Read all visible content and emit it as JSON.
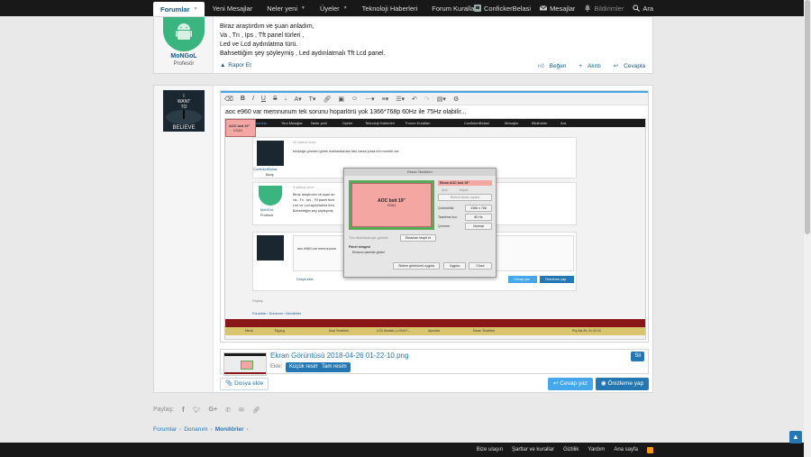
{
  "nav": {
    "tabs": [
      {
        "label": "Forumlar",
        "active": true
      },
      {
        "label": "Yeni Mesajlar"
      },
      {
        "label": "Neler yeni"
      },
      {
        "label": "Üyeler"
      },
      {
        "label": "Teknoloji Haberleri"
      },
      {
        "label": "Forum Kuralları"
      }
    ],
    "user": "ConfickerBelasi",
    "messages": "Mesajlar",
    "alerts": "Bildirimler",
    "search": "Ara"
  },
  "post1": {
    "username": "MoNGoL",
    "usertitle": "Profesör",
    "lines": [
      "Biraz araştırdım ve şuan anladım,",
      "Va , Tn , Ips , Tft panel türleri ,",
      "Led ve Lcd aydınlatma türü.",
      "Bahsettiğim şey şöyleymiş , Led aydınlatmalı Tft Lcd panel."
    ],
    "report": "Rapor Et",
    "like": "Beğen",
    "quote": "Alıntı",
    "reply": "Cevapla"
  },
  "reply": {
    "believe_lines": [
      "I",
      "WANT",
      "TO",
      "BELIEVE"
    ],
    "editor_text": "aoc e960 var memnunum tek sorunu hoparlörü yok 1366*768p 60Hz ile 75Hz olabilir...",
    "shot": {
      "nav": [
        "Forumlar",
        "Yeni Mesajlar",
        "Neler yeni",
        "Üyeler",
        "Teknoloji Haberleri",
        "Forum Kuralları"
      ],
      "nav_right": [
        "ConfickerBelasi",
        "Mesajlar",
        "Bildirimler",
        "Ara"
      ],
      "time1": "20 dakika önce",
      "text1": "sıkıştığa çıkmam gerek dokkantlardan fakı varsa yolsa teıl monitör var.",
      "user1": "ConfickerBelasi",
      "user1_title": "Bahş",
      "time2": "3 dakika önce",
      "user2": "MoNGoL",
      "user2_title": "Profesör",
      "text2": [
        "Biraz araştırdım ve şuan an",
        "Va , Tn , Ips , Tft panel türle",
        "Led ve Lcd aydınlatma türü.",
        "Bahsettiğim şey şöyleymiş"
      ],
      "editor_text": "aoc e960 var memnunum",
      "attach": "Dosya ekle",
      "reply": "Cevap yaz",
      "preview": "Önizleme yap",
      "share": "Paylaş:",
      "crumbs": [
        "Forumlar",
        "Donanım",
        "Monitörler"
      ],
      "dialog": {
        "title": "Ekran Tercihleri",
        "monitor": "AOC bsit 19\"",
        "monitor_sub": "VGA1",
        "panel_name": "Ekran AOC bsit 19\"",
        "on": "Açık",
        "off": "Kapalı",
        "detect": "Birincil ekranı ayarla",
        "res_label": "Çözünürlük:",
        "res_value": "1366 x 768",
        "rate_label": "Tazeleme hızı:",
        "rate_value": "60 Hz",
        "rot_label": "Çevirme:",
        "rot_value": "Normal",
        "mirror": "Tüm ekranlarda aynı görüntü",
        "detect_btn": "Ekranları tespit et",
        "panel_label": "Panel simgesi",
        "panel_opt": "Ekranım panelde göster",
        "restore": "Sistem görünümü uygula",
        "apply": "Uygula",
        "close": "Close"
      },
      "taskbar": [
        "Menü",
        "Eşya.g",
        "Dosi Tercihleri",
        "LCD Monitör | LGVA F...",
        "Ayrımlar",
        "Ekran Tercihleri"
      ],
      "clock": "Prş Nis 26, 01:22:10"
    }
  },
  "attachment": {
    "filename": "Ekran Görüntüsü 2018-04-26 01-22-10.png",
    "insert_label": "Ekle:",
    "thumb_btn": "Küçük resim",
    "full_btn": "Tam resim",
    "delete_btn": "Sil"
  },
  "buttons": {
    "attach": "Dosya ekle",
    "reply": "Cevap yaz",
    "preview": "Önizleme yap"
  },
  "share": {
    "label": "Paylaş:"
  },
  "breadcrumb": [
    "Forumlar",
    "Donanım",
    "Monitörler"
  ],
  "footer": {
    "links": [
      "Bize ulaşın",
      "Şartlar ve kurallar",
      "Gizlilik",
      "Yardım",
      "Ana sayfa"
    ]
  }
}
